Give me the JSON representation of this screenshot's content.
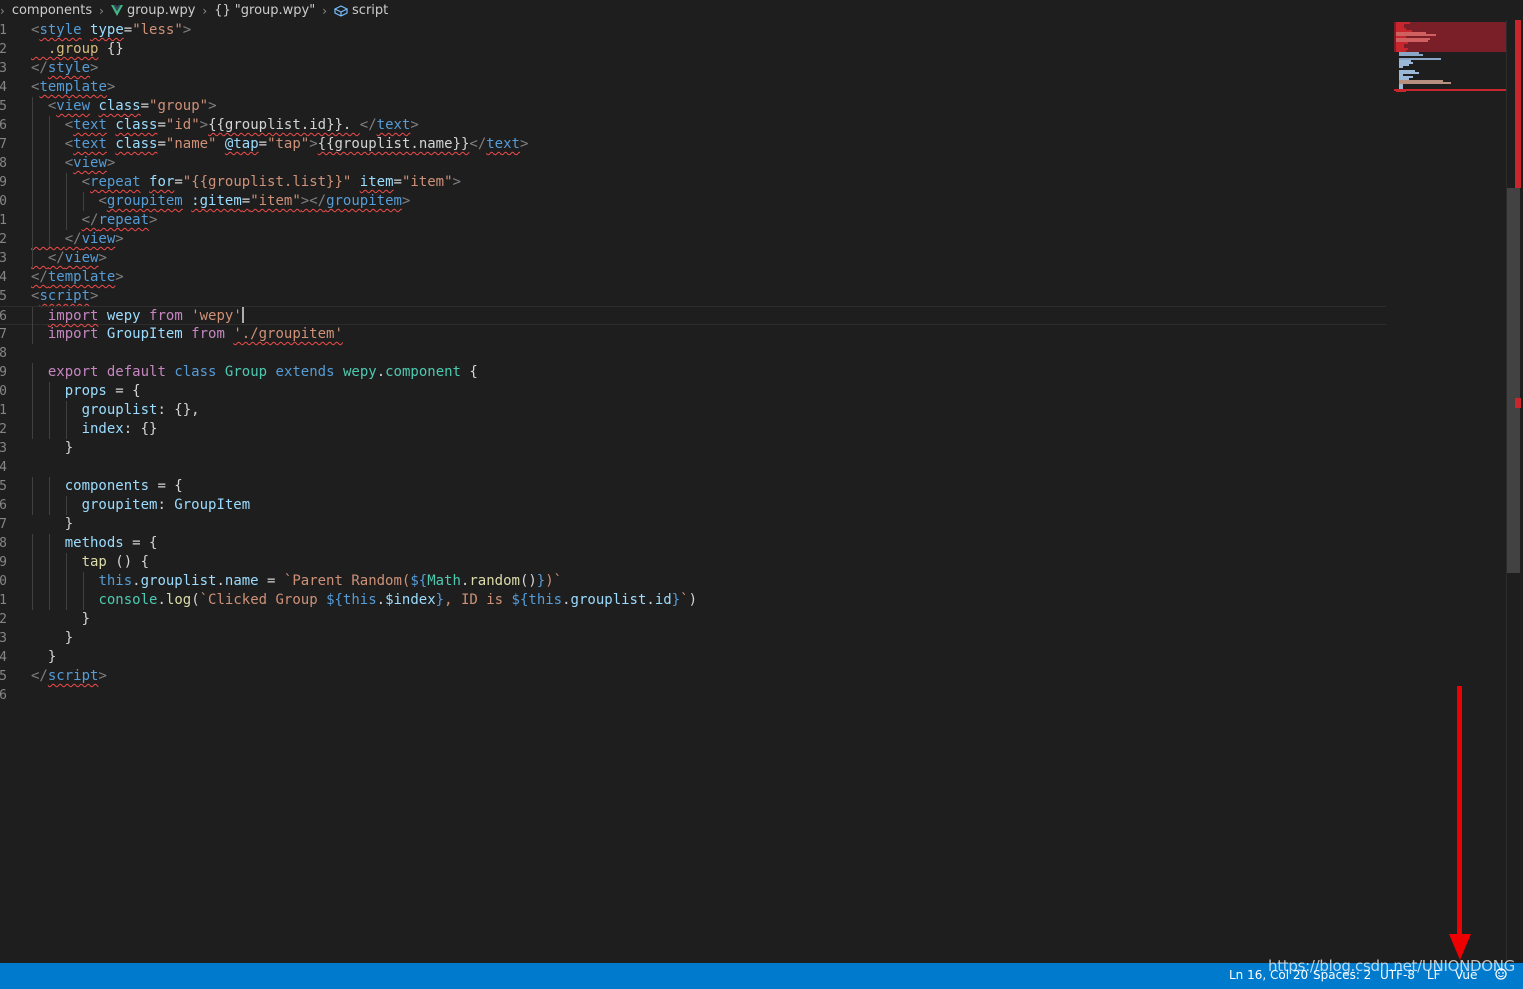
{
  "breadcrumb": {
    "folder": "components",
    "file": "group.wpy",
    "object": "\"group.wpy\"",
    "object_icon": "{}",
    "section": "script"
  },
  "editor": {
    "line_numbers": [
      "1",
      "2",
      "3",
      "4",
      "5",
      "6",
      "7",
      "8",
      "9",
      "0",
      "1",
      "2",
      "3",
      "4",
      "5",
      "6",
      "7",
      "8",
      "9",
      "0",
      "1",
      "2",
      "3",
      "4",
      "5",
      "6",
      "7",
      "8",
      "9",
      "0",
      "1",
      "2",
      "3",
      "4",
      "5",
      "6"
    ],
    "current_line_index": 15,
    "lines": [
      [
        [
          "tk-punct",
          "<"
        ],
        [
          "tk-tag sq",
          "style"
        ],
        [
          "tk-plain",
          " "
        ],
        [
          "tk-attr sq",
          "type"
        ],
        [
          "tk-plain",
          "="
        ],
        [
          "tk-str",
          "\"less\""
        ],
        [
          "tk-punct",
          ">"
        ]
      ],
      [
        [
          "tk-sel sq",
          "  .group"
        ],
        [
          "tk-plain",
          " {}"
        ]
      ],
      [
        [
          "tk-punct",
          "</"
        ],
        [
          "tk-tag sq",
          "style"
        ],
        [
          "tk-punct",
          ">"
        ]
      ],
      [
        [
          "tk-punct",
          "<"
        ],
        [
          "tk-tag sq",
          "template"
        ],
        [
          "tk-punct",
          ">"
        ]
      ],
      [
        [
          "tk-plain",
          "  "
        ],
        [
          "tk-punct",
          "<"
        ],
        [
          "tk-tag sq",
          "view"
        ],
        [
          "tk-plain",
          " "
        ],
        [
          "tk-attr sq",
          "class"
        ],
        [
          "tk-plain",
          "="
        ],
        [
          "tk-str",
          "\"group\""
        ],
        [
          "tk-punct",
          ">"
        ]
      ],
      [
        [
          "tk-plain",
          "    "
        ],
        [
          "tk-punct",
          "<"
        ],
        [
          "tk-tag sq",
          "text"
        ],
        [
          "tk-plain",
          " "
        ],
        [
          "tk-attr sq",
          "class"
        ],
        [
          "tk-plain",
          "="
        ],
        [
          "tk-str",
          "\"id\""
        ],
        [
          "tk-punct",
          ">"
        ],
        [
          "tk-plain sq",
          "{{grouplist.id}}. "
        ],
        [
          "tk-punct",
          "</"
        ],
        [
          "tk-tag sq",
          "text"
        ],
        [
          "tk-punct",
          ">"
        ]
      ],
      [
        [
          "tk-plain",
          "    "
        ],
        [
          "tk-punct",
          "<"
        ],
        [
          "tk-tag sq",
          "text"
        ],
        [
          "tk-plain",
          " "
        ],
        [
          "tk-attr sq",
          "class"
        ],
        [
          "tk-plain",
          "="
        ],
        [
          "tk-str",
          "\"name\""
        ],
        [
          "tk-plain",
          " "
        ],
        [
          "tk-attr sq",
          "@tap"
        ],
        [
          "tk-plain",
          "="
        ],
        [
          "tk-str",
          "\"tap\""
        ],
        [
          "tk-punct",
          ">"
        ],
        [
          "tk-plain sq",
          "{{grouplist.name}}"
        ],
        [
          "tk-punct",
          "</"
        ],
        [
          "tk-tag sq",
          "text"
        ],
        [
          "tk-punct",
          ">"
        ]
      ],
      [
        [
          "tk-plain",
          "    "
        ],
        [
          "tk-punct",
          "<"
        ],
        [
          "tk-tag sq",
          "view"
        ],
        [
          "tk-punct",
          ">"
        ]
      ],
      [
        [
          "tk-plain",
          "      "
        ],
        [
          "tk-punct",
          "<"
        ],
        [
          "tk-tag sq",
          "repeat"
        ],
        [
          "tk-plain",
          " "
        ],
        [
          "tk-attr sq",
          "for"
        ],
        [
          "tk-plain",
          "="
        ],
        [
          "tk-str",
          "\"{{grouplist.list}}\""
        ],
        [
          "tk-plain",
          " "
        ],
        [
          "tk-attr sq",
          "item"
        ],
        [
          "tk-plain",
          "="
        ],
        [
          "tk-str",
          "\"item\""
        ],
        [
          "tk-punct",
          ">"
        ]
      ],
      [
        [
          "tk-plain",
          "        "
        ],
        [
          "tk-punct",
          "<"
        ],
        [
          "tk-tag sq",
          "groupitem"
        ],
        [
          "tk-plain",
          " "
        ],
        [
          "tk-attr sq",
          ":gitem"
        ],
        [
          "tk-plain sq",
          "="
        ],
        [
          "tk-str sq",
          "\"item\""
        ],
        [
          "tk-punct sq",
          "></"
        ],
        [
          "tk-tag sq",
          "groupitem"
        ],
        [
          "tk-punct",
          ">"
        ]
      ],
      [
        [
          "tk-plain",
          "      "
        ],
        [
          "tk-punct sq",
          "</"
        ],
        [
          "tk-tag sq",
          "repeat"
        ],
        [
          "tk-punct",
          ">"
        ]
      ],
      [
        [
          "tk-plain sq",
          "    "
        ],
        [
          "tk-punct sq",
          "</"
        ],
        [
          "tk-tag sq",
          "view"
        ],
        [
          "tk-punct",
          ">"
        ]
      ],
      [
        [
          "tk-plain sq",
          "  "
        ],
        [
          "tk-punct sq",
          "</"
        ],
        [
          "tk-tag sq",
          "view"
        ],
        [
          "tk-punct",
          ">"
        ]
      ],
      [
        [
          "tk-punct sq",
          "</"
        ],
        [
          "tk-tag sq",
          "template"
        ],
        [
          "tk-punct",
          ">"
        ]
      ],
      [
        [
          "tk-punct",
          "<"
        ],
        [
          "tk-tag sq",
          "script"
        ],
        [
          "tk-punct",
          ">"
        ]
      ],
      [
        [
          "tk-plain",
          "  "
        ],
        [
          "tk-kw sq",
          "import"
        ],
        [
          "tk-plain",
          " "
        ],
        [
          "tk-var",
          "wepy"
        ],
        [
          "tk-plain",
          " "
        ],
        [
          "tk-kw",
          "from"
        ],
        [
          "tk-plain",
          " "
        ],
        [
          "tk-str",
          "'wepy'"
        ]
      ],
      [
        [
          "tk-plain",
          "  "
        ],
        [
          "tk-kw",
          "import"
        ],
        [
          "tk-plain",
          " "
        ],
        [
          "tk-var",
          "GroupItem"
        ],
        [
          "tk-plain",
          " "
        ],
        [
          "tk-kw",
          "from"
        ],
        [
          "tk-plain",
          " "
        ],
        [
          "tk-str sq",
          "'./groupitem'"
        ]
      ],
      [],
      [
        [
          "tk-plain",
          "  "
        ],
        [
          "tk-kw",
          "export"
        ],
        [
          "tk-plain",
          " "
        ],
        [
          "tk-kw",
          "default"
        ],
        [
          "tk-plain",
          " "
        ],
        [
          "tk-kw2",
          "class"
        ],
        [
          "tk-plain",
          " "
        ],
        [
          "tk-cls",
          "Group"
        ],
        [
          "tk-plain",
          " "
        ],
        [
          "tk-kw2",
          "extends"
        ],
        [
          "tk-plain",
          " "
        ],
        [
          "tk-cls",
          "wepy"
        ],
        [
          "tk-plain",
          "."
        ],
        [
          "tk-cls",
          "component"
        ],
        [
          "tk-plain",
          " {"
        ]
      ],
      [
        [
          "tk-plain",
          "    "
        ],
        [
          "tk-var",
          "props"
        ],
        [
          "tk-plain",
          " = {"
        ]
      ],
      [
        [
          "tk-plain",
          "      "
        ],
        [
          "tk-var",
          "grouplist"
        ],
        [
          "tk-plain",
          ": {},"
        ]
      ],
      [
        [
          "tk-plain",
          "      "
        ],
        [
          "tk-var",
          "index"
        ],
        [
          "tk-plain",
          ": {}"
        ]
      ],
      [
        [
          "tk-plain",
          "    }"
        ]
      ],
      [],
      [
        [
          "tk-plain",
          "    "
        ],
        [
          "tk-var",
          "components"
        ],
        [
          "tk-plain",
          " = {"
        ]
      ],
      [
        [
          "tk-plain",
          "      "
        ],
        [
          "tk-var",
          "groupitem"
        ],
        [
          "tk-plain",
          ": "
        ],
        [
          "tk-var",
          "GroupItem"
        ]
      ],
      [
        [
          "tk-plain",
          "    }"
        ]
      ],
      [
        [
          "tk-plain",
          "    "
        ],
        [
          "tk-var",
          "methods"
        ],
        [
          "tk-plain",
          " = {"
        ]
      ],
      [
        [
          "tk-plain",
          "      "
        ],
        [
          "tk-fn",
          "tap"
        ],
        [
          "tk-plain",
          " () {"
        ]
      ],
      [
        [
          "tk-plain",
          "        "
        ],
        [
          "tk-kw2",
          "this"
        ],
        [
          "tk-plain",
          "."
        ],
        [
          "tk-var",
          "grouplist"
        ],
        [
          "tk-plain",
          "."
        ],
        [
          "tk-var",
          "name"
        ],
        [
          "tk-plain",
          " = "
        ],
        [
          "tk-str",
          "`Parent Random("
        ],
        [
          "tk-kw2",
          "${"
        ],
        [
          "tk-cls",
          "Math"
        ],
        [
          "tk-plain",
          "."
        ],
        [
          "tk-fn",
          "random"
        ],
        [
          "tk-plain",
          "()"
        ],
        [
          "tk-kw2",
          "}"
        ],
        [
          "tk-str",
          ")`"
        ]
      ],
      [
        [
          "tk-plain",
          "        "
        ],
        [
          "tk-cls",
          "console"
        ],
        [
          "tk-plain",
          "."
        ],
        [
          "tk-fn",
          "log"
        ],
        [
          "tk-plain",
          "("
        ],
        [
          "tk-str",
          "`Clicked Group "
        ],
        [
          "tk-kw2",
          "${"
        ],
        [
          "tk-kw2",
          "this"
        ],
        [
          "tk-plain",
          "."
        ],
        [
          "tk-var",
          "$index"
        ],
        [
          "tk-kw2",
          "}"
        ],
        [
          "tk-str",
          ", ID is "
        ],
        [
          "tk-kw2",
          "${"
        ],
        [
          "tk-kw2",
          "this"
        ],
        [
          "tk-plain",
          "."
        ],
        [
          "tk-var",
          "grouplist"
        ],
        [
          "tk-plain",
          "."
        ],
        [
          "tk-var",
          "id"
        ],
        [
          "tk-kw2",
          "}"
        ],
        [
          "tk-str",
          "`"
        ],
        [
          "tk-plain",
          ")"
        ]
      ],
      [
        [
          "tk-plain",
          "      }"
        ]
      ],
      [
        [
          "tk-plain",
          "    }"
        ]
      ],
      [
        [
          "tk-plain",
          "  }"
        ]
      ],
      [
        [
          "tk-punct",
          "</"
        ],
        [
          "tk-tag sq",
          "script"
        ],
        [
          "tk-punct",
          ">"
        ]
      ],
      []
    ]
  },
  "status": {
    "position": "Ln 16, Col 20",
    "spaces": "Spaces: 2",
    "encoding": "UTF-8",
    "eol": "LF",
    "language": "Vue"
  },
  "watermark": "https://blog.csdn.net/UNIONDONG",
  "colors": {
    "statusbar": "#007acc",
    "background": "#1e1e1e",
    "annotation_arrow": "#ee0000"
  }
}
